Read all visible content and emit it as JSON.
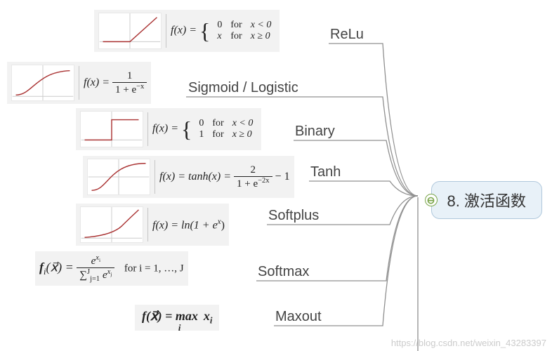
{
  "central": {
    "title": "8. 激活函数",
    "collapse_glyph": "⊖"
  },
  "branches": [
    {
      "key": "relu",
      "label": "ReLu"
    },
    {
      "key": "sigmoid",
      "label": "Sigmoid / Logistic"
    },
    {
      "key": "binary",
      "label": "Binary"
    },
    {
      "key": "tanh",
      "label": "Tanh"
    },
    {
      "key": "softplus",
      "label": "Softplus"
    },
    {
      "key": "softmax",
      "label": "Softmax"
    },
    {
      "key": "maxout",
      "label": "Maxout"
    }
  ],
  "formulas": {
    "relu": {
      "lhs": "f(x) =",
      "cases": [
        [
          "0",
          "for",
          "x < 0"
        ],
        [
          "x",
          "for",
          "x ≥ 0"
        ]
      ]
    },
    "sigmoid": {
      "lhs": "f(x) =",
      "frac_num": "1",
      "frac_den": "1 + e",
      "frac_den_sup": "−x"
    },
    "binary": {
      "lhs": "f(x) =",
      "cases": [
        [
          "0",
          "for",
          "x < 0"
        ],
        [
          "1",
          "for",
          "x ≥ 0"
        ]
      ]
    },
    "tanh": {
      "lhs": "f(x) = tanh(x) =",
      "frac_num": "2",
      "frac_den": "1 + e",
      "frac_den_sup": "−2x",
      "tail": " − 1"
    },
    "softplus": {
      "lhs": "f(x) = ln(1 + e",
      "sup": "x",
      "tail": ")"
    },
    "softmax": {
      "lhs": "f",
      "sub_i": "i",
      "arg": "(x⃗) = ",
      "frac_num_e": "e",
      "frac_num_sup": "x",
      "frac_num_sub": "i",
      "sum_pre": "∑",
      "sum_sub": "j=1",
      "sum_sup": "J",
      "sum_body_e": " e",
      "sum_body_sup": "x",
      "sum_body_sub": "j",
      "for_text": "for i = 1, …, J"
    },
    "maxout": {
      "text": "f(x⃗) = max",
      "sub": "i",
      "tail": " x",
      "tail_sub": "i"
    }
  },
  "chart_data": [
    {
      "name": "relu",
      "type": "line",
      "x": [
        -3,
        -2,
        -1,
        0,
        1,
        2,
        3
      ],
      "y": [
        0,
        0,
        0,
        0,
        1,
        2,
        3
      ],
      "xlim": [
        -3,
        3
      ],
      "ylim": [
        -0.5,
        3
      ]
    },
    {
      "name": "sigmoid",
      "type": "line",
      "x": [
        -6,
        -4,
        -2,
        0,
        2,
        4,
        6
      ],
      "y": [
        0.002,
        0.018,
        0.119,
        0.5,
        0.881,
        0.982,
        0.998
      ],
      "xlim": [
        -6,
        6
      ],
      "ylim": [
        0,
        1
      ]
    },
    {
      "name": "binary",
      "type": "line",
      "x": [
        -3,
        -0.001,
        0,
        3
      ],
      "y": [
        0,
        0,
        1,
        1
      ],
      "xlim": [
        -3,
        3
      ],
      "ylim": [
        -0.2,
        1.2
      ]
    },
    {
      "name": "tanh",
      "type": "line",
      "x": [
        -3,
        -2,
        -1,
        0,
        1,
        2,
        3
      ],
      "y": [
        -0.995,
        -0.964,
        -0.762,
        0,
        0.762,
        0.964,
        0.995
      ],
      "xlim": [
        -3,
        3
      ],
      "ylim": [
        -1,
        1
      ]
    },
    {
      "name": "softplus",
      "type": "line",
      "x": [
        -4,
        -2,
        0,
        2,
        4
      ],
      "y": [
        0.018,
        0.127,
        0.693,
        2.127,
        4.018
      ],
      "xlim": [
        -4,
        4
      ],
      "ylim": [
        0,
        4
      ]
    }
  ],
  "watermark": "https://blog.csdn.net/weixin_43283397"
}
